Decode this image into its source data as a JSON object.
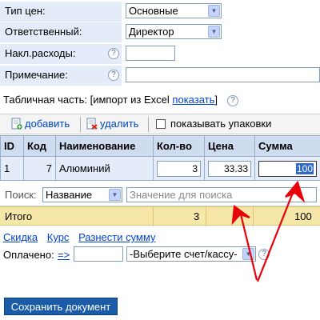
{
  "form": {
    "price_type": {
      "label": "Тип цен:",
      "value": "Основные"
    },
    "responsible": {
      "label": "Ответственный:",
      "value": "Директор"
    },
    "overhead": {
      "label": "Накл.расходы:",
      "value": ""
    },
    "note": {
      "label": "Примечание:",
      "value": ""
    },
    "help_glyph": "?"
  },
  "table_part": {
    "prefix": "Табличная часть: [импорт из Excel ",
    "show_link": "показать",
    "suffix": "]"
  },
  "toolbar": {
    "add_label": "добавить",
    "delete_label": "удалить",
    "show_packages_label": "показывать упаковки"
  },
  "grid": {
    "headers": [
      "ID",
      "Код",
      "Наименование",
      "Кол-во",
      "Цена",
      "Сумма"
    ],
    "rows": [
      {
        "id": "1",
        "code": "7",
        "name": "Алюминий",
        "qty": "3",
        "price": "33.33",
        "sum": "100"
      }
    ]
  },
  "search": {
    "label": "Поиск:",
    "field": "Название",
    "placeholder": "Значение для поиска"
  },
  "totals": {
    "label": "Итого",
    "qty": "3",
    "sum": "100"
  },
  "links": {
    "discount": "Скидка",
    "rate": "Курс",
    "distribute": "Разнести сумму"
  },
  "payment": {
    "label": "Оплачено:",
    "arrow_link": "=>",
    "amount": "",
    "account_placeholder": "-Выберите счет/кассу-"
  },
  "save_label": "Сохранить документ",
  "colors": {
    "arrow": "#e8000b",
    "accent": "#1a5ca8",
    "total_bg": "#f5e7a8"
  }
}
